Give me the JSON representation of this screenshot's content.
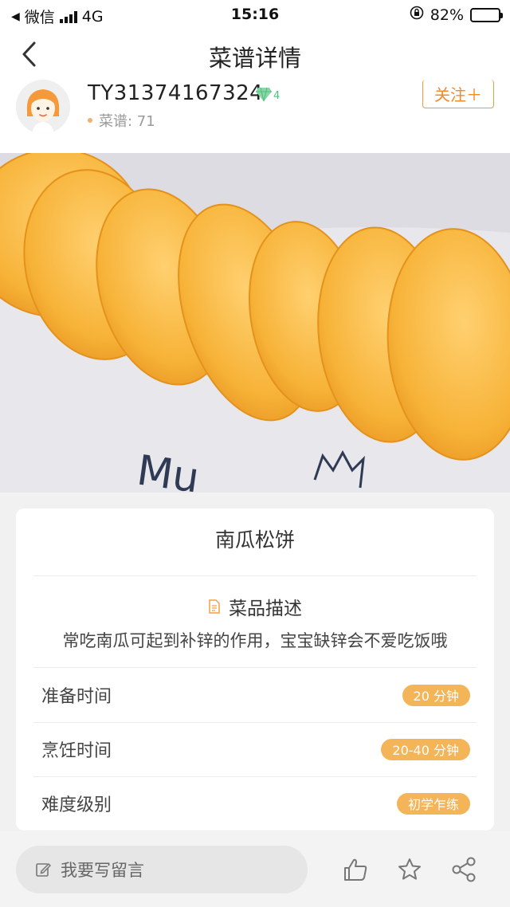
{
  "status_bar": {
    "carrier": "微信",
    "network": "4G",
    "time": "15:16",
    "battery": "82%",
    "battery_level": 0.82
  },
  "header": {
    "title": "菜谱详情"
  },
  "author": {
    "username": "TY31374167324",
    "level": "4",
    "recipes_label": "菜谱: 71",
    "follow_label": "关注＋"
  },
  "hero": {
    "plate_text": "Mu"
  },
  "recipe": {
    "name": "南瓜松饼",
    "description_heading": "菜品描述",
    "description": "常吃南瓜可起到补锌的作用，宝宝缺锌会不爱吃饭哦",
    "rows": [
      {
        "label": "准备时间",
        "value": "20 分钟"
      },
      {
        "label": "烹饪时间",
        "value": "20-40 分钟"
      },
      {
        "label": "难度级别",
        "value": "初学乍练"
      }
    ]
  },
  "bottom_bar": {
    "comment_placeholder": "我要写留言"
  },
  "colors": {
    "accent": "#f08a2a",
    "pill": "#f4b458",
    "gem": "#4cc07a"
  }
}
